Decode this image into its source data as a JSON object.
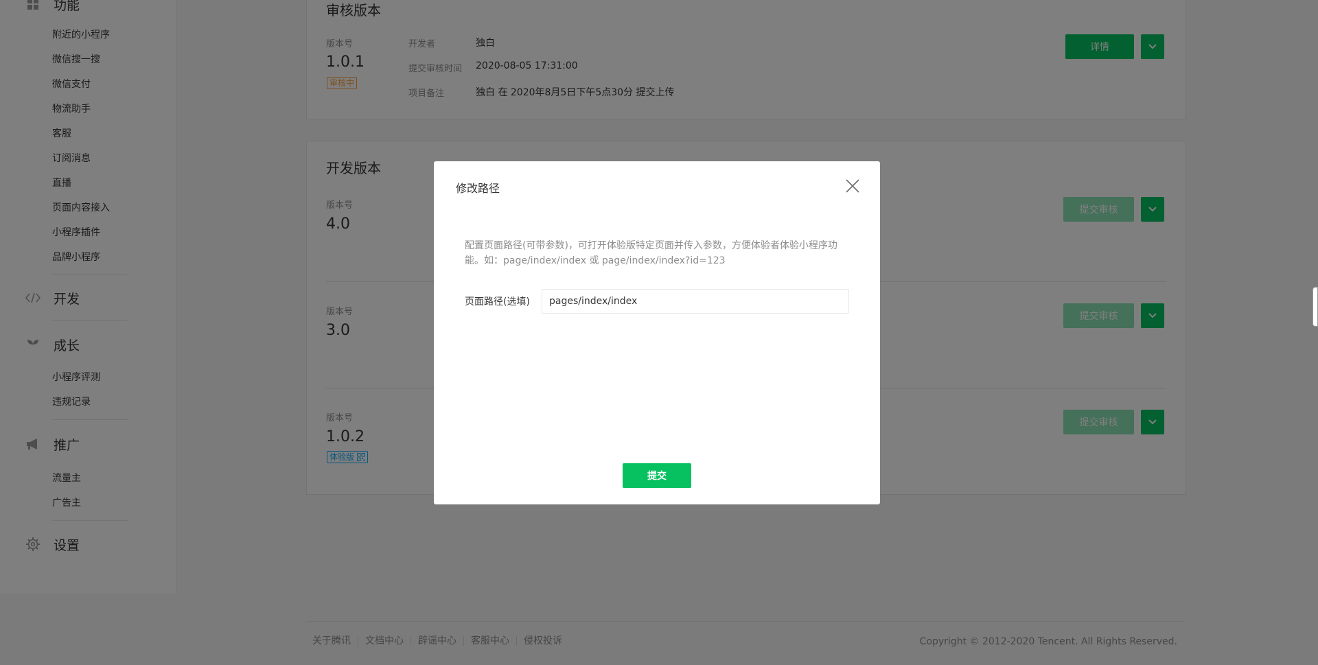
{
  "sidebar": {
    "partial_section": "功能",
    "feature_items": [
      "附近的小程序",
      "微信搜一搜",
      "微信支付",
      "物流助手",
      "客服",
      "订阅消息",
      "直播",
      "页面内容接入",
      "小程序插件",
      "品牌小程序"
    ],
    "develop_label": "开发",
    "growth_label": "成长",
    "growth_items": [
      "小程序评测",
      "违规记录"
    ],
    "promote_label": "推广",
    "promote_items": [
      "流量主",
      "广告主"
    ],
    "settings_label": "设置"
  },
  "review_version": {
    "title": "审核版本",
    "version_label": "版本号",
    "version": "1.0.1",
    "badge": "审核中",
    "developer_label": "开发者",
    "developer": "独白",
    "submit_time_label": "提交审核时间",
    "submit_time": "2020-08-05 17:31:00",
    "remark_label": "项目备注",
    "remark": "独白 在 2020年8月5日下午5点30分 提交上传",
    "detail_button": "详情",
    "badge_color": "#fa9d3b"
  },
  "dev_versions": {
    "title": "开发版本",
    "version_label": "版本号",
    "submit_button": "提交审核",
    "items": [
      {
        "version": "4.0"
      },
      {
        "version": "3.0"
      },
      {
        "version": "1.0.2",
        "badge": "体验版"
      }
    ],
    "badge_color": "#10aeff"
  },
  "footer": {
    "links": [
      "关于腾讯",
      "文档中心",
      "辟谣中心",
      "客服中心",
      "侵权投诉"
    ],
    "copyright": "Copyright © 2012-2020 Tencent. All Rights Reserved."
  },
  "dialog": {
    "title": "修改路径",
    "description": "配置页面路径(可带参数)，可打开体验版特定页面并传入参数，方便体验者体验小程序功能。如：page/index/index 或 page/index/index?id=123",
    "field_label": "页面路径(选填)",
    "field_value": "pages/index/index",
    "submit_label": "提交",
    "close_icon": "close-icon"
  },
  "colors": {
    "brand_green": "#07c160",
    "overlay": "rgba(0,0,0,0.5)"
  }
}
